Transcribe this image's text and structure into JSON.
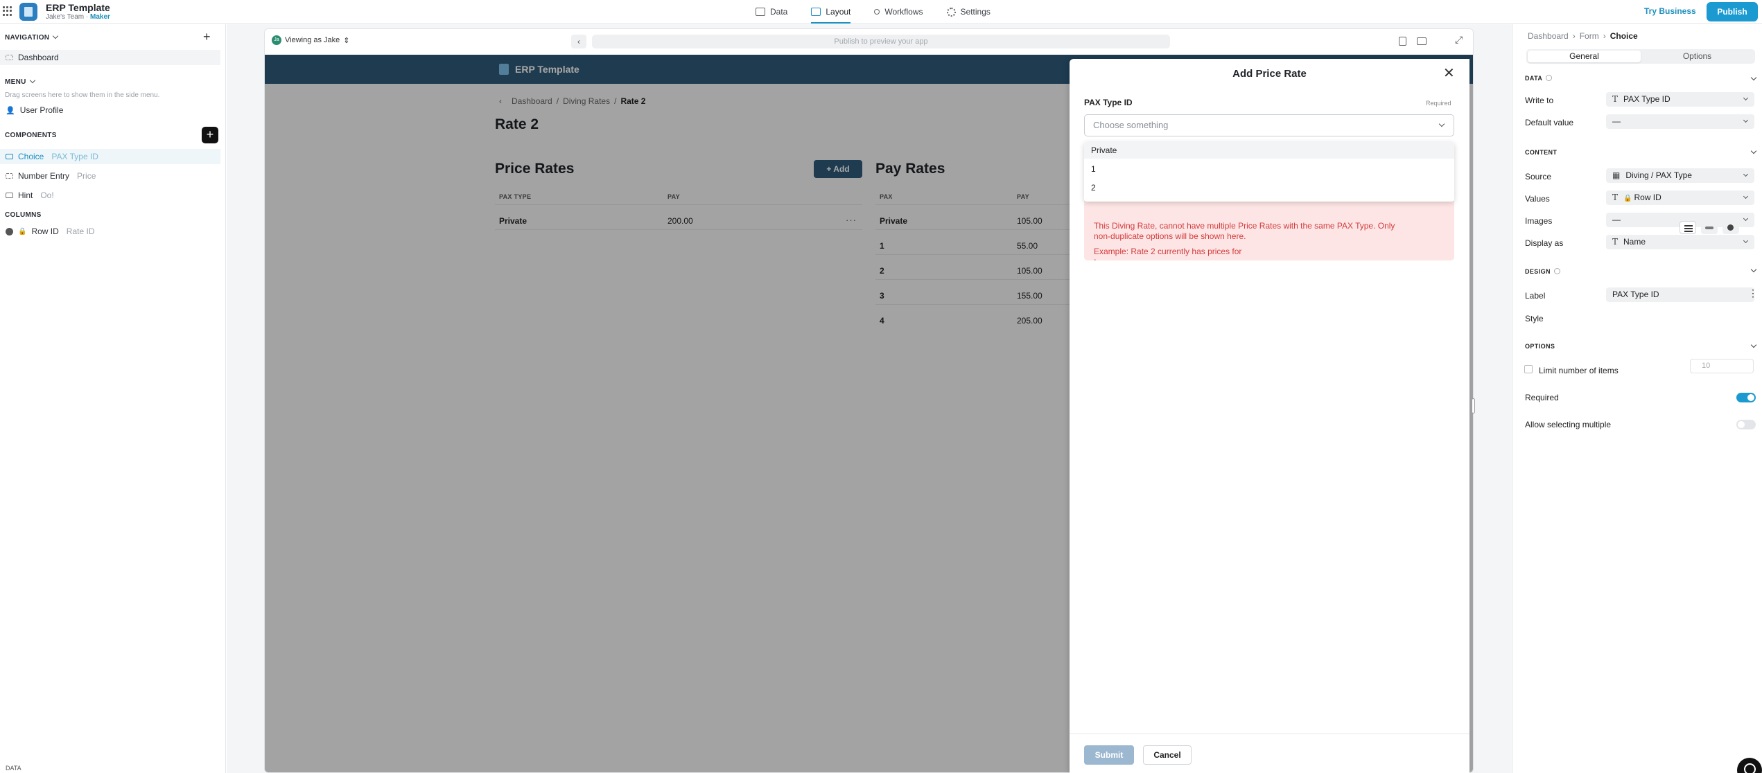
{
  "topbar": {
    "app_name": "ERP Template",
    "team": "Jake's Team",
    "role": "Maker",
    "tabs": [
      {
        "label": "Data",
        "icon": "table-icon"
      },
      {
        "label": "Layout",
        "icon": "layout-icon",
        "active": true
      },
      {
        "label": "Workflows",
        "icon": "workflow-icon"
      },
      {
        "label": "Settings",
        "icon": "gear-icon"
      }
    ],
    "try_business": "Try Business",
    "publish": "Publish"
  },
  "left": {
    "navigation_header": "NAVIGATION",
    "navigation_items": [
      "Dashboard"
    ],
    "menu_header": "MENU",
    "menu_hint": "Drag screens here to show them in the side menu.",
    "menu_items": [
      "User Profile"
    ],
    "components_header": "COMPONENTS",
    "components": [
      {
        "label": "Choice",
        "sub": "PAX Type ID",
        "selected": true
      },
      {
        "label": "Number Entry",
        "sub": "Price"
      },
      {
        "label": "Hint",
        "sub": "Oo!"
      }
    ],
    "columns_header": "COLUMNS",
    "columns": [
      {
        "label": "Row ID",
        "sub": "Rate ID"
      }
    ],
    "bottom_label": "DATA"
  },
  "preview": {
    "viewing_as": "Viewing as Jake",
    "avatar": "Ja",
    "url_placeholder": "Publish to preview your app",
    "app_title": "ERP Template",
    "breadcrumb": [
      "Dashboard",
      "Diving Rates",
      "Rate 2"
    ],
    "page_title": "Rate 2",
    "price_rates": {
      "title": "Price Rates",
      "add_label": "Add",
      "columns": [
        "PAX TYPE",
        "PAY"
      ],
      "rows": [
        {
          "pax": "Private",
          "pay": "200.00"
        }
      ]
    },
    "pay_rates": {
      "title": "Pay Rates",
      "columns": [
        "PAX",
        "PAY"
      ],
      "rows": [
        {
          "pax": "Private",
          "pay": "105.00"
        },
        {
          "pax": "1",
          "pay": "55.00"
        },
        {
          "pax": "2",
          "pay": "105.00"
        },
        {
          "pax": "3",
          "pay": "155.00"
        },
        {
          "pax": "4",
          "pay": "205.00"
        }
      ]
    }
  },
  "modal": {
    "title": "Add Price Rate",
    "field_label": "PAX Type ID",
    "required": "Required",
    "select_placeholder": "Choose something",
    "options": [
      "Private",
      "1",
      "2"
    ],
    "error_line1": "This Diving Rate, cannot have multiple Price Rates with the same PAX Type. Only",
    "error_line2": "non-duplicate options will be shown here.",
    "error_line3": "Example: Rate 2 currently has prices for",
    "error_line4": "-",
    "submit": "Submit",
    "cancel": "Cancel"
  },
  "right": {
    "breadcrumb": [
      "Dashboard",
      "Form",
      "Choice"
    ],
    "tabs": [
      "General",
      "Options"
    ],
    "data_header": "DATA",
    "write_to_label": "Write to",
    "write_to_value": "PAX Type ID",
    "default_value_label": "Default value",
    "default_value": "—",
    "content_header": "CONTENT",
    "source_label": "Source",
    "source_value": "Diving / PAX Type",
    "values_label": "Values",
    "values_value": "Row ID",
    "images_label": "Images",
    "images_value": "—",
    "display_as_label": "Display as",
    "display_as_value": "Name",
    "design_header": "DESIGN",
    "label_label": "Label",
    "label_value": "PAX Type ID",
    "style_label": "Style",
    "options_header": "OPTIONS",
    "limit_label": "Limit number of items",
    "limit_value": "10",
    "required_label": "Required",
    "required_on": true,
    "multiple_label": "Allow selecting multiple",
    "multiple_on": false
  }
}
